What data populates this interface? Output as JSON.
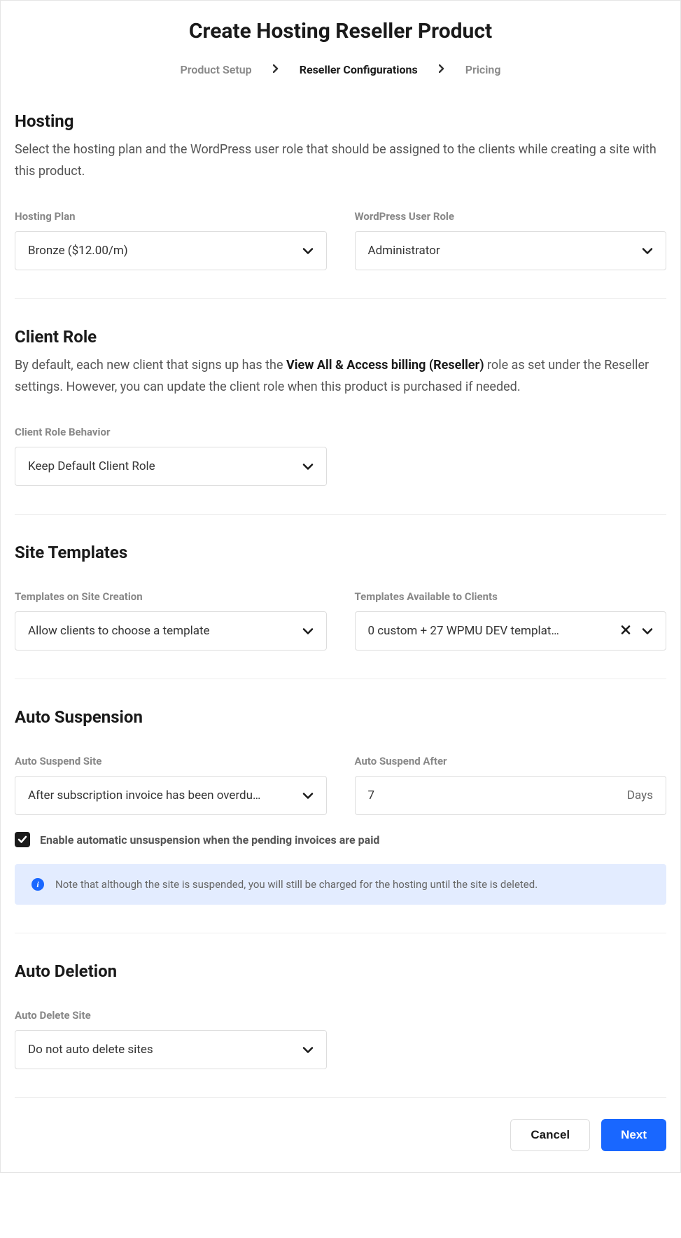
{
  "title": "Create Hosting Reseller Product",
  "steps": {
    "product_setup": "Product Setup",
    "reseller_config": "Reseller Configurations",
    "pricing": "Pricing"
  },
  "hosting": {
    "heading": "Hosting",
    "desc": "Select the hosting plan and the WordPress user role that should be assigned to the clients while creating a site with this product.",
    "plan_label": "Hosting Plan",
    "plan_value": "Bronze ($12.00/m)",
    "role_label": "WordPress User Role",
    "role_value": "Administrator"
  },
  "client_role": {
    "heading": "Client Role",
    "desc_prefix": "By default, each new client that signs up has the ",
    "desc_bold": "View All & Access billing (Reseller)",
    "desc_suffix": " role as set under the Reseller settings. However, you can update the client role when this product is purchased if needed.",
    "behavior_label": "Client Role Behavior",
    "behavior_value": "Keep Default Client Role"
  },
  "site_templates": {
    "heading": "Site Templates",
    "creation_label": "Templates on Site Creation",
    "creation_value": "Allow clients to choose a template",
    "available_label": "Templates Available to Clients",
    "available_value": "0 custom + 27 WPMU DEV templat…"
  },
  "auto_suspension": {
    "heading": "Auto Suspension",
    "suspend_label": "Auto Suspend Site",
    "suspend_value": "After subscription invoice has been overdu…",
    "after_label": "Auto Suspend After",
    "after_value": "7",
    "after_unit": "Days",
    "checkbox_label": "Enable automatic unsuspension when the pending invoices are paid",
    "note": "Note that although the site is suspended, you will still be charged for the hosting until the site is deleted."
  },
  "auto_deletion": {
    "heading": "Auto Deletion",
    "delete_label": "Auto Delete Site",
    "delete_value": "Do not auto delete sites"
  },
  "footer": {
    "cancel": "Cancel",
    "next": "Next"
  }
}
